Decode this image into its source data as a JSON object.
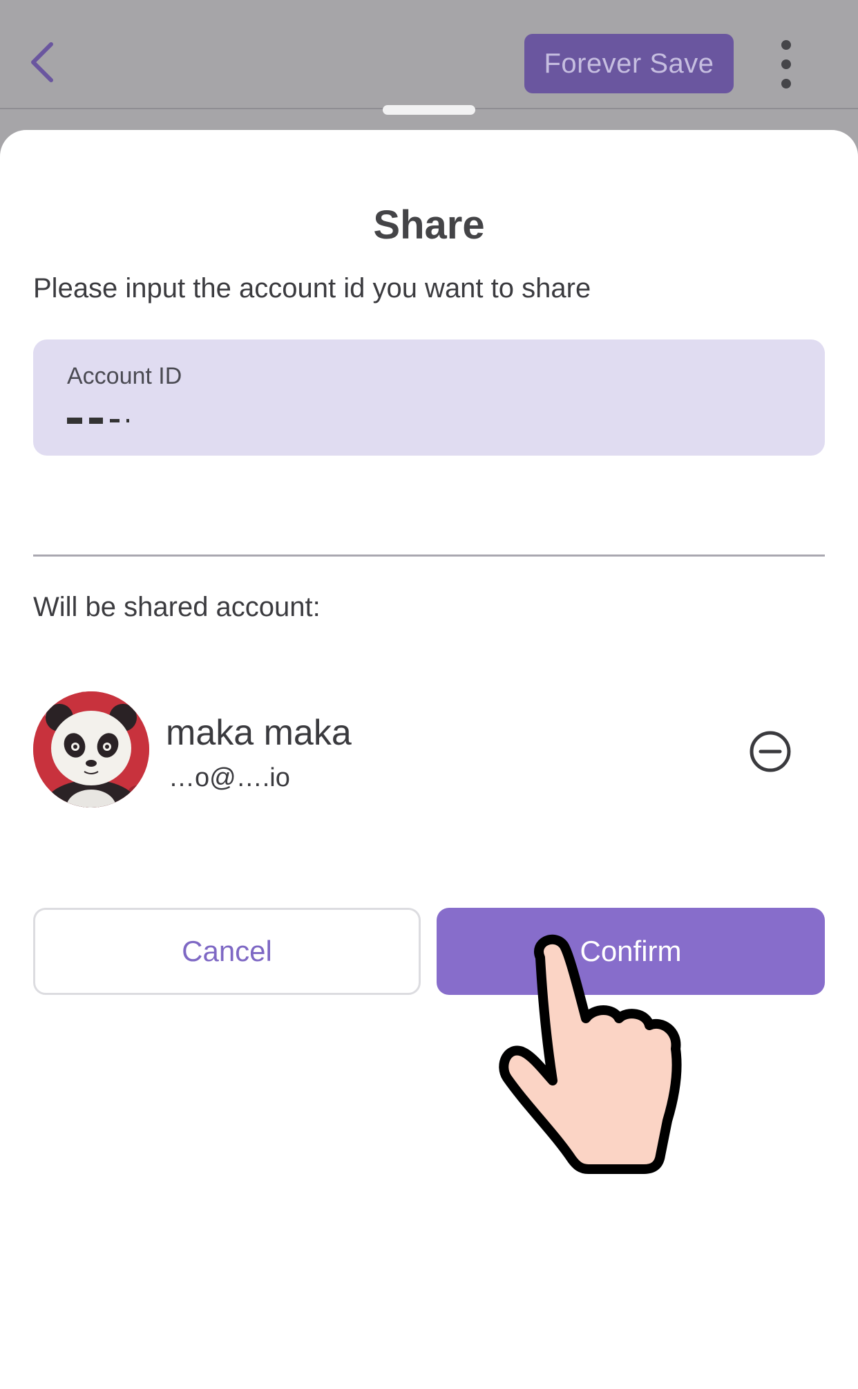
{
  "header": {
    "back_icon": "chevron-left-icon",
    "forever_save_label": "Forever Save",
    "more_icon": "more-vertical-icon"
  },
  "dialog": {
    "title": "Share",
    "prompt": "Please input the account id you want to share",
    "account_field": {
      "label": "Account ID",
      "value_redacted": true
    },
    "shared_label": "Will be shared account:",
    "shared_account": {
      "name": "maka maka",
      "email": "…o@….io",
      "remove_icon": "minus-circle-icon",
      "avatar": "panda-avatar"
    },
    "cancel_label": "Cancel",
    "confirm_label": "Confirm"
  },
  "overlay": {
    "pointer_icon": "hand-pointer-icon"
  },
  "colors": {
    "accent": "#876dcb",
    "field_bg": "#e0dcf1",
    "dim_header": "#a6a5a8"
  }
}
